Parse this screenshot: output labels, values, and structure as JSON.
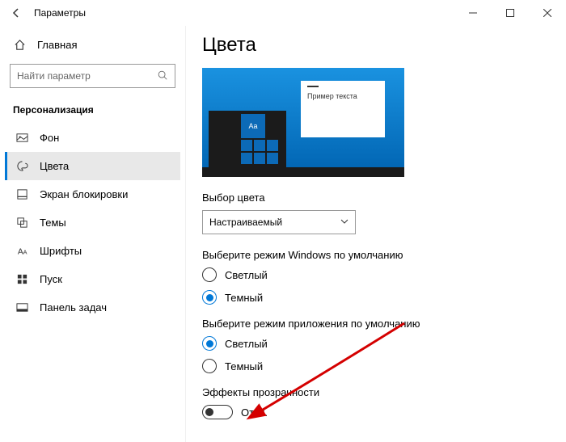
{
  "window": {
    "title": "Параметры"
  },
  "sidebar": {
    "home": "Главная",
    "search_placeholder": "Найти параметр",
    "section": "Персонализация",
    "items": [
      {
        "label": "Фон"
      },
      {
        "label": "Цвета"
      },
      {
        "label": "Экран блокировки"
      },
      {
        "label": "Темы"
      },
      {
        "label": "Шрифты"
      },
      {
        "label": "Пуск"
      },
      {
        "label": "Панель задач"
      }
    ]
  },
  "page": {
    "title": "Цвета",
    "preview_text": "Пример текста",
    "preview_tile": "Aa",
    "color_choice_label": "Выбор цвета",
    "color_choice_value": "Настраиваемый",
    "windows_mode_label": "Выберите режим Windows по умолчанию",
    "windows_mode_light": "Светлый",
    "windows_mode_dark": "Темный",
    "app_mode_label": "Выберите режим приложения по умолчанию",
    "app_mode_light": "Светлый",
    "app_mode_dark": "Темный",
    "transparency_label": "Эффекты прозрачности",
    "transparency_state": "Откл."
  }
}
